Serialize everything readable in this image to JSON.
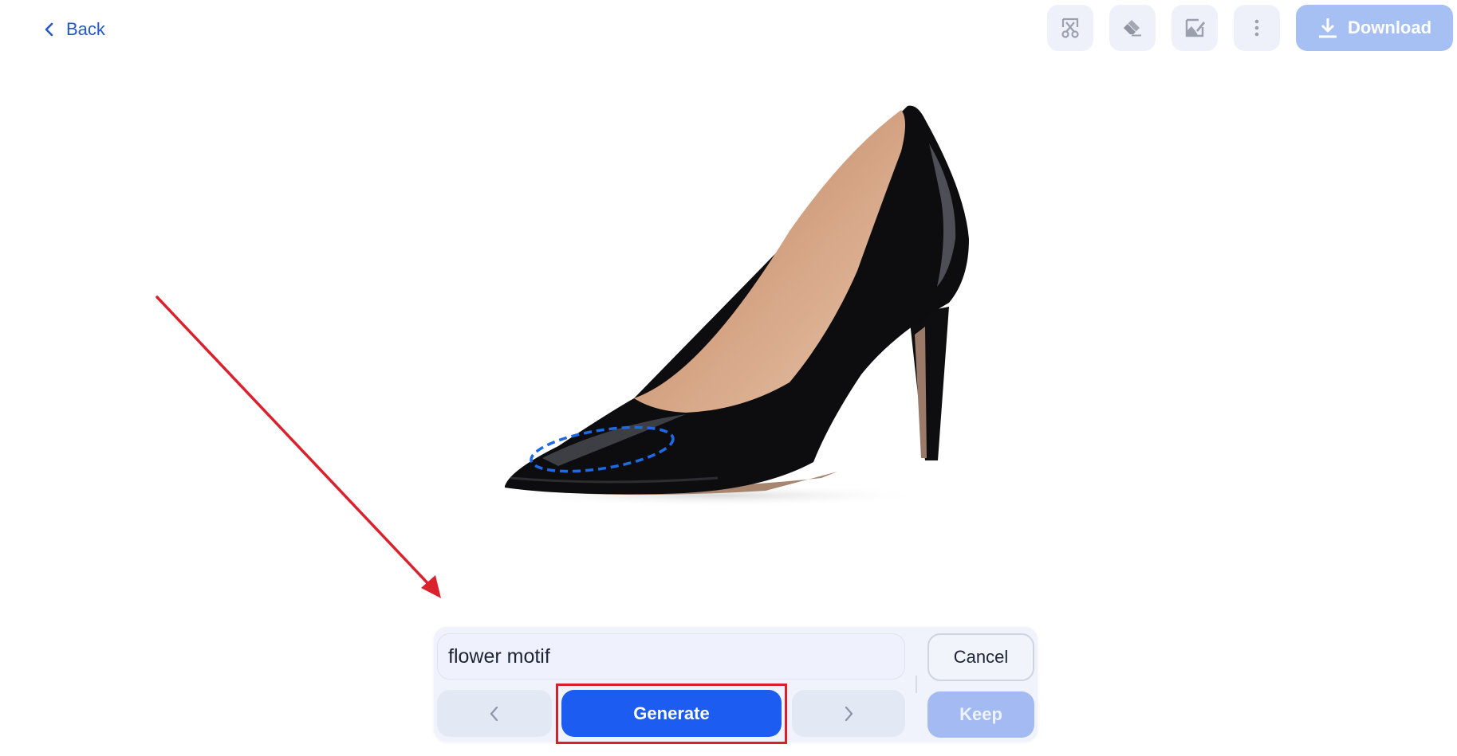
{
  "header": {
    "back_label": "Back",
    "back_icon": "chevron-left-icon",
    "toolbar": [
      {
        "name": "cutout-tool",
        "icon": "scissors-crop-icon"
      },
      {
        "name": "eraser-tool",
        "icon": "eraser-icon"
      },
      {
        "name": "edit-image-tool",
        "icon": "image-edit-icon"
      },
      {
        "name": "more-options",
        "icon": "more-vertical-icon"
      }
    ],
    "download_label": "Download",
    "download_icon": "download-icon"
  },
  "canvas": {
    "image_subject": "black patent leather pointed-toe stiletto pump",
    "selection": "dashed blue lasso around shoe toe",
    "annotation": "red arrow pointing to prompt panel"
  },
  "prompt_panel": {
    "input_value": "flower motif",
    "prev_icon": "chevron-left-icon",
    "generate_label": "Generate",
    "next_icon": "chevron-right-icon",
    "cancel_label": "Cancel",
    "keep_label": "Keep"
  },
  "colors": {
    "accent": "#1d5cf0",
    "link": "#2558c9",
    "highlight": "#d91f2a",
    "disabled_primary": "#a7c0f3"
  }
}
